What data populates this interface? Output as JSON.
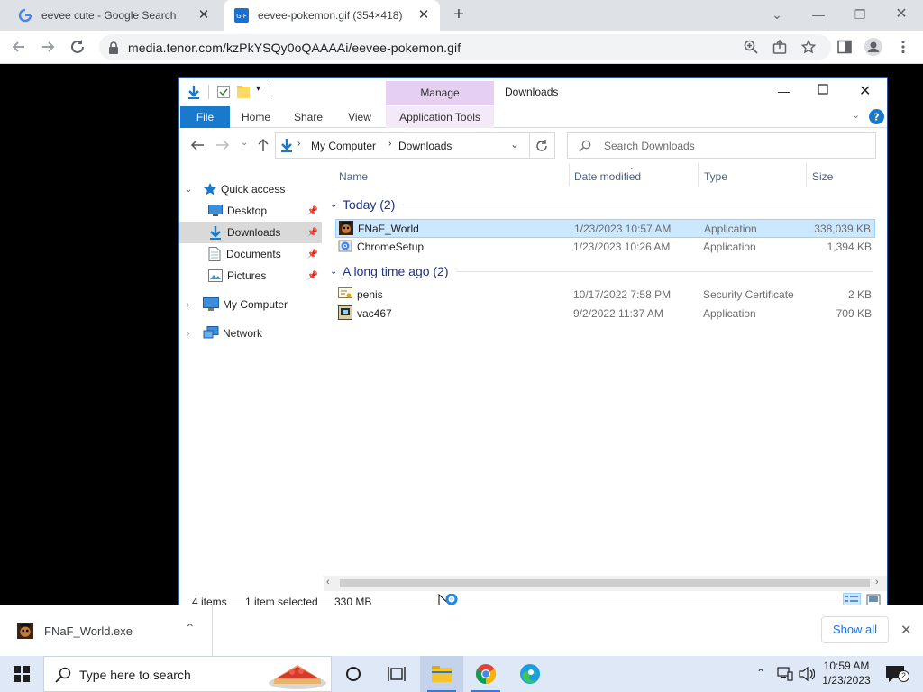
{
  "browser": {
    "tabs": [
      {
        "title": "eevee cute - Google Search"
      },
      {
        "title": "eevee-pokemon.gif (354×418)"
      }
    ],
    "url": "media.tenor.com/kzPkYSQy0oQAAAAi/eevee-pokemon.gif"
  },
  "explorer": {
    "window_title": "Downloads",
    "manage_label": "Manage",
    "ribbon_tabs": [
      "File",
      "Home",
      "Share",
      "View",
      "Application Tools"
    ],
    "breadcrumb": [
      "My Computer",
      "Downloads"
    ],
    "search_placeholder": "Search Downloads",
    "nav": {
      "quick_access": "Quick access",
      "items": [
        "Desktop",
        "Downloads",
        "Documents",
        "Pictures"
      ],
      "my_computer": "My Computer",
      "network": "Network"
    },
    "columns": {
      "name": "Name",
      "date": "Date modified",
      "type": "Type",
      "size": "Size"
    },
    "groups": [
      {
        "label": "Today (2)",
        "files": [
          {
            "name": "FNaF_World",
            "date": "1/23/2023 10:57 AM",
            "type": "Application",
            "size": "338,039 KB"
          },
          {
            "name": "ChromeSetup",
            "date": "1/23/2023 10:26 AM",
            "type": "Application",
            "size": "1,394 KB"
          }
        ]
      },
      {
        "label": "A long time ago (2)",
        "files": [
          {
            "name": "penis",
            "date": "10/17/2022 7:58 PM",
            "type": "Security Certificate",
            "size": "2 KB"
          },
          {
            "name": "vac467",
            "date": "9/2/2022 11:37 AM",
            "type": "Application",
            "size": "709 KB"
          }
        ]
      }
    ],
    "status": {
      "count": "4 items",
      "selected": "1 item selected",
      "size": "330 MB"
    }
  },
  "download_bar": {
    "file": "FNaF_World.exe",
    "show_all": "Show all"
  },
  "taskbar": {
    "search_placeholder": "Type here to search",
    "time": "10:59 AM",
    "date": "1/23/2023",
    "notification_count": "2"
  },
  "colors": {
    "accent": "#1979ca",
    "selection": "#cce8ff",
    "manage_tab": "#e6d0f1",
    "chrome_frame": "#dee1e6",
    "taskbar": "#dfe8f7"
  }
}
